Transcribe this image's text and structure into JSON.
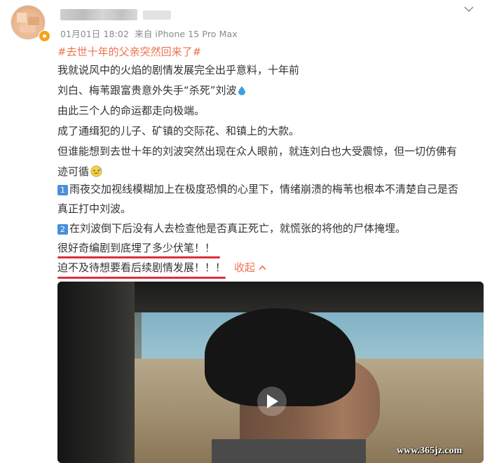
{
  "post": {
    "meta": {
      "date": "01月01日",
      "time": "18:02",
      "source": "来自 iPhone 15 Pro Max"
    },
    "topic": "#去世十年的父亲突然回来了#",
    "lines": [
      "我就说风中的火焰的剧情发展完全出乎意料，十年前",
      "刘白、梅苇跟富贵意外失手“杀死”刘波",
      "由此三个人的命运都走向极端。",
      "成了通缉犯的儿子、矿镇的交际花、和镇上的大款。",
      "但谁能想到去世十年的刘波突然出现在众人眼前，就连刘白也大受震惊，但一切仿佛有",
      "迹可循",
      "雨夜交加视线模糊加上在极度恐惧的心里下，情绪崩溃的梅苇也根本不清楚自己是否",
      "真正打中刘波。",
      "在刘波倒下后没有人去检查他是否真正死亡，就慌张的将他的尸体掩埋。",
      "很好奇编剧到底埋了多少伏笔！！",
      "迫不及待想要看后续剧情发展！！！"
    ],
    "numbers": [
      "1",
      "2"
    ],
    "collapse_label": "收起"
  },
  "icons": {
    "verified": "verified-badge-icon",
    "more": "chevron-down-icon",
    "drop": "water-drop-emoji-icon",
    "face": "sweat-emoji-icon",
    "play": "play-icon"
  },
  "colors": {
    "topic": "#eb7350",
    "number_badge": "#4a90d9",
    "underline": "#d8313a"
  },
  "watermark": "www.365jz.com"
}
